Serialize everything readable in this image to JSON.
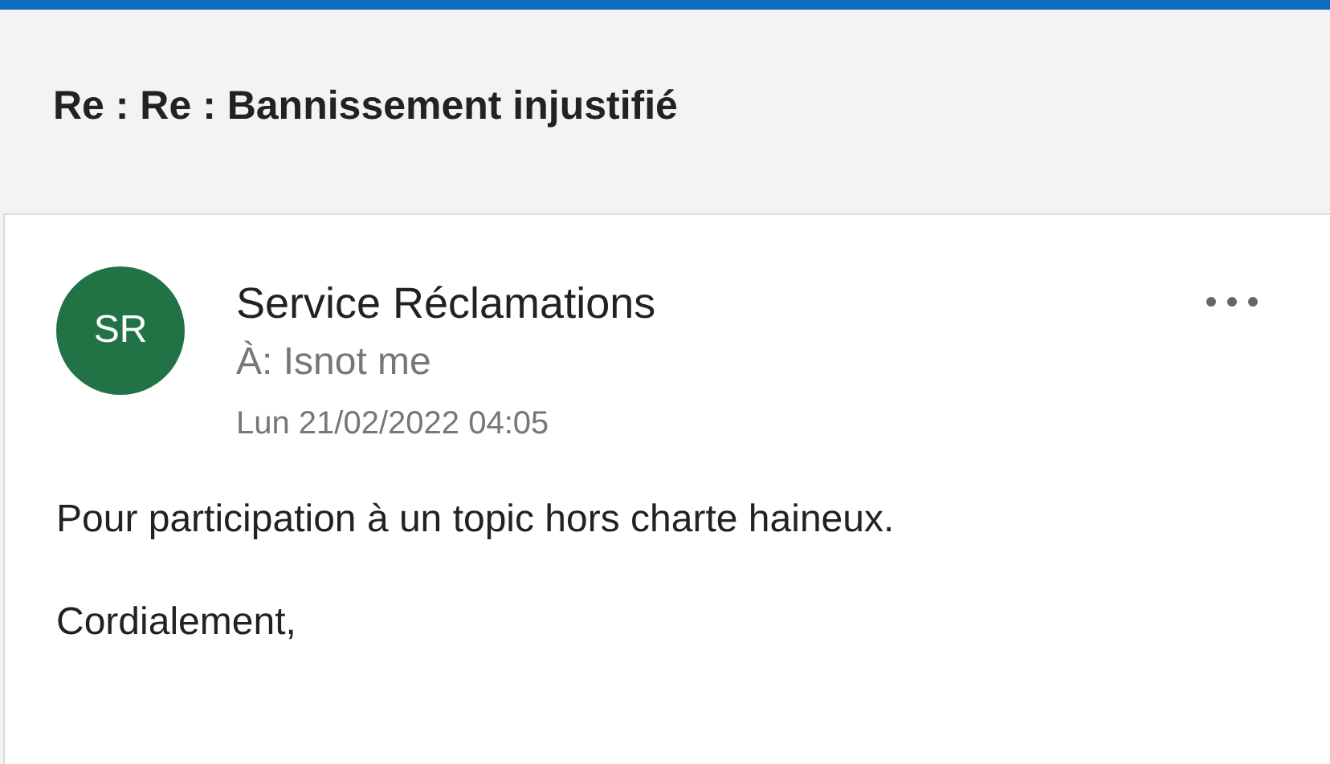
{
  "subject": "Re : Re : Bannissement injustifié",
  "message": {
    "avatar": {
      "initials": "SR",
      "color": "#217346"
    },
    "sender": "Service Réclamations",
    "to": "À: Isnot me",
    "date": "Lun 21/02/2022 04:05",
    "body": [
      "Pour participation à un topic hors charte haineux.",
      "Cordialement,"
    ]
  }
}
